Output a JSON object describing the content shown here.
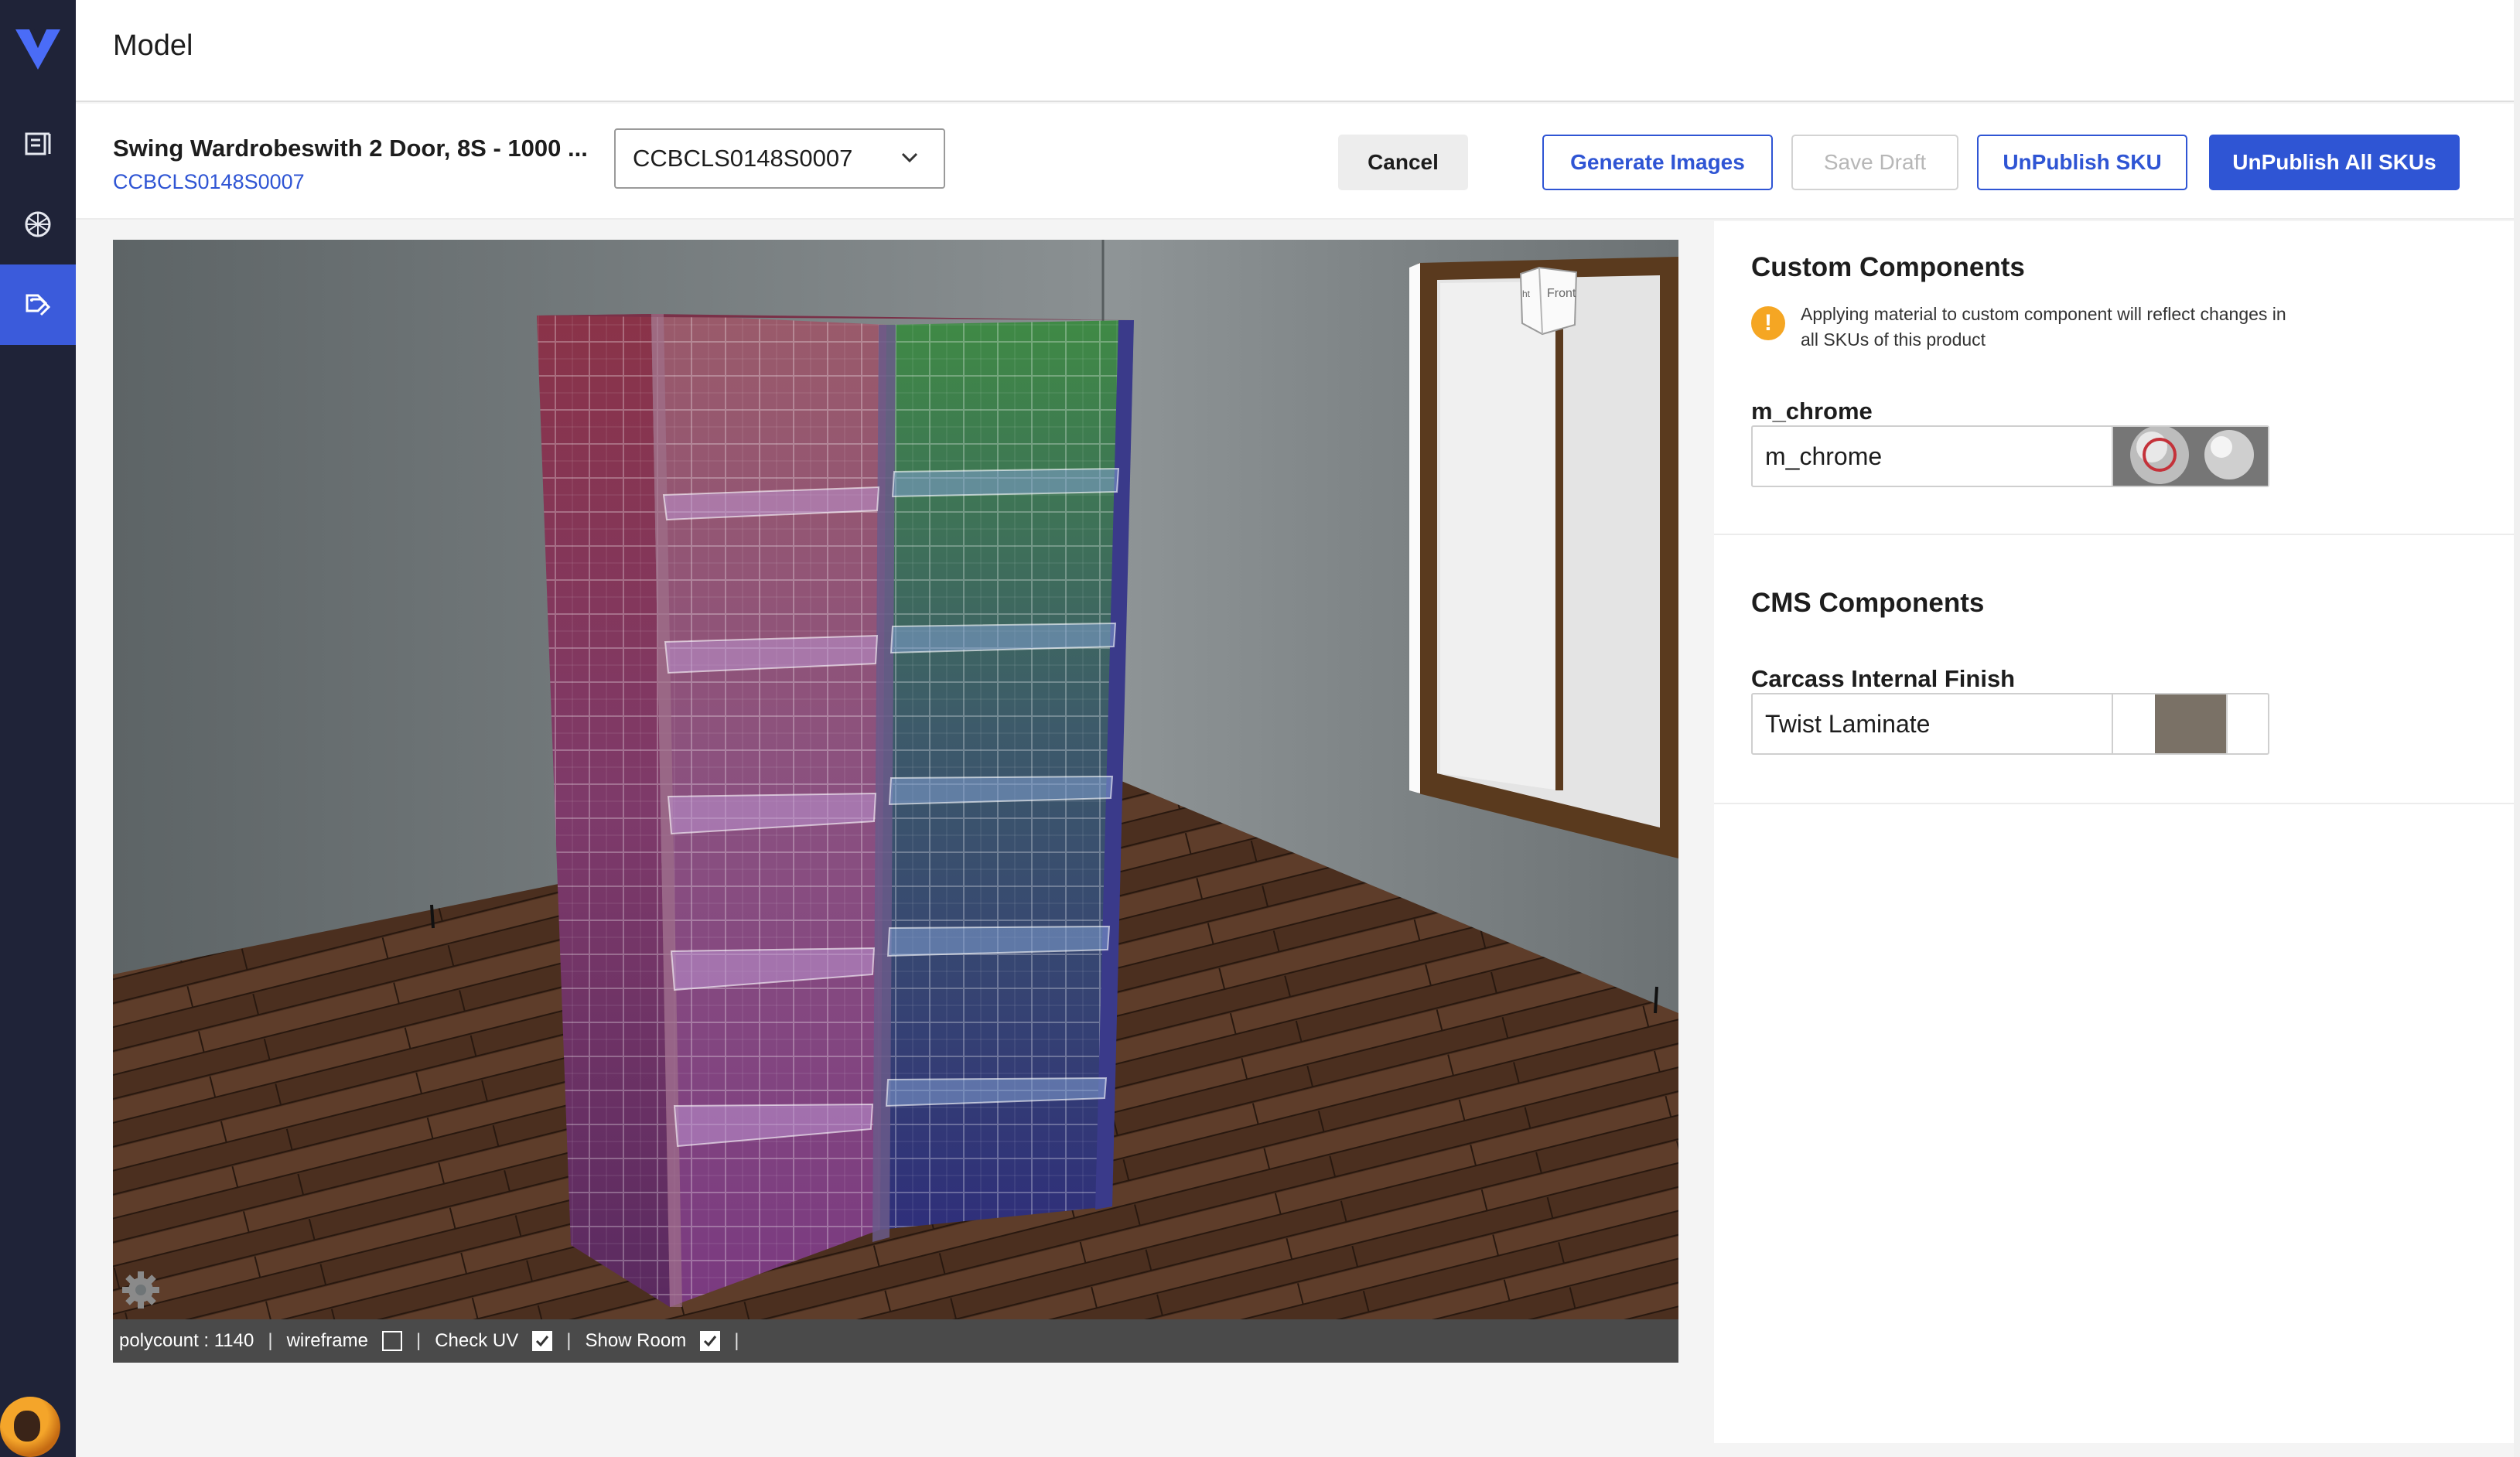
{
  "app": {
    "page_title": "Model"
  },
  "sidebar": {
    "items": [
      {
        "icon": "book-icon"
      },
      {
        "icon": "material-ball-icon"
      },
      {
        "icon": "tags-icon",
        "active": true
      }
    ]
  },
  "product": {
    "name": "Swing Wardrobeswith 2 Door, 8S - 1000 ...",
    "sku": "CCBCLS0148S0007",
    "selected_sku": "CCBCLS0148S0007"
  },
  "actions": {
    "cancel": "Cancel",
    "generate_images": "Generate Images",
    "save_draft": "Save Draft",
    "unpublish_sku": "UnPublish SKU",
    "unpublish_all": "UnPublish All SKUs"
  },
  "viewport": {
    "status": {
      "polycount": "polycount : 1140",
      "sep": "|",
      "wireframe_label": "wireframe",
      "wireframe_checked": false,
      "check_uv_label": "Check UV",
      "check_uv_checked": true,
      "show_room_label": "Show Room",
      "show_room_checked": true
    },
    "view_cube": {
      "front_label": "Front",
      "side_label": "ht"
    }
  },
  "custom_components": {
    "heading": "Custom Components",
    "notice": "Applying material to custom component will reflect changes in all SKUs of this product",
    "items": [
      {
        "label": "m_chrome",
        "value": "m_chrome"
      }
    ]
  },
  "cms_components": {
    "heading": "CMS Components",
    "items": [
      {
        "label": "Carcass Internal Finish",
        "value": "Twist Laminate",
        "swatch_color": "#7a7166"
      }
    ]
  },
  "colors": {
    "rail": "#1f2338",
    "accent": "#2f55d4",
    "active_nav": "#3b5bdb",
    "warning": "#f5a623"
  }
}
